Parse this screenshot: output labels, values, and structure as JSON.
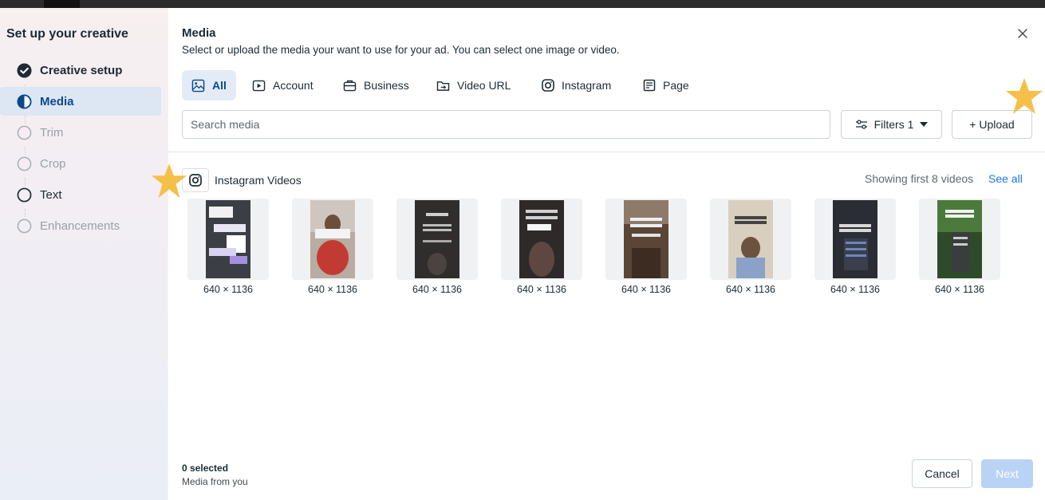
{
  "sidebar": {
    "title": "Set up your creative",
    "steps": [
      {
        "label": "Creative setup",
        "state": "done"
      },
      {
        "label": "Media",
        "state": "active"
      },
      {
        "label": "Trim",
        "state": "disabled"
      },
      {
        "label": "Crop",
        "state": "disabled"
      },
      {
        "label": "Text",
        "state": "enabled"
      },
      {
        "label": "Enhancements",
        "state": "disabled"
      }
    ]
  },
  "header": {
    "title": "Media",
    "subtitle": "Select or upload the media your want to use for your ad. You can select one image or video."
  },
  "tabs": [
    {
      "label": "All",
      "icon": "image-icon"
    },
    {
      "label": "Account",
      "icon": "video-icon"
    },
    {
      "label": "Business",
      "icon": "briefcase-icon"
    },
    {
      "label": "Video URL",
      "icon": "link-icon"
    },
    {
      "label": "Instagram",
      "icon": "instagram-icon"
    },
    {
      "label": "Page",
      "icon": "page-icon"
    }
  ],
  "search": {
    "placeholder": "Search media",
    "value": ""
  },
  "filters_label": "Filters 1",
  "upload_label": "+ Upload",
  "section": {
    "title": "Instagram Videos",
    "count_text": "Showing first 8 videos",
    "see_all": "See all"
  },
  "videos": [
    {
      "dims": "640 × 1136"
    },
    {
      "dims": "640 × 1136"
    },
    {
      "dims": "640 × 1136"
    },
    {
      "dims": "640 × 1136"
    },
    {
      "dims": "640 × 1136"
    },
    {
      "dims": "640 × 1136"
    },
    {
      "dims": "640 × 1136"
    },
    {
      "dims": "640 × 1136"
    }
  ],
  "footer": {
    "selected": "0 selected",
    "source": "Media from you",
    "cancel": "Cancel",
    "next": "Next"
  },
  "colors": {
    "accent": "#1877f2",
    "active_tab_bg": "#e3ebf6",
    "next_disabled": "#b9d3f5",
    "star": "#f5c04a"
  }
}
